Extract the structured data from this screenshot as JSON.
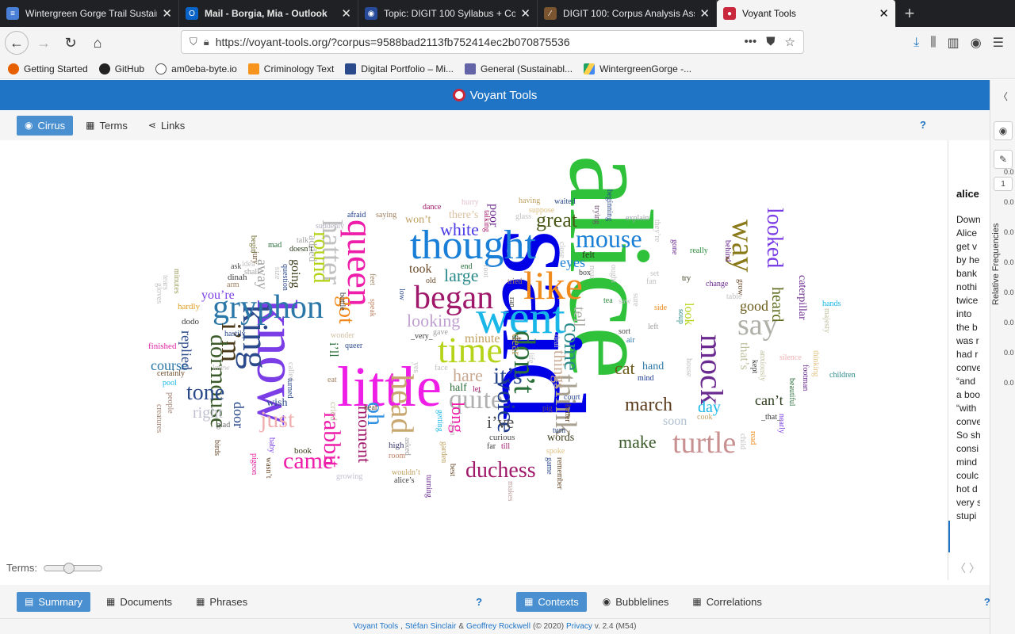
{
  "browser": {
    "tabs": [
      {
        "title": "Wintergreen Gorge Trail Sustain",
        "icon_color": "#4a7fd8",
        "icon": "doc-icon"
      },
      {
        "title": "Mail - Borgia, Mia - Outlook",
        "icon_color": "#0a64c8",
        "icon": "outlook-icon"
      },
      {
        "title": "Topic: DIGIT 100 Syllabus + Co",
        "icon_color": "#284a9b",
        "icon": "globe-icon"
      },
      {
        "title": "DIGIT 100: Corpus Analysis Ass",
        "icon_color": "#7a5530",
        "icon": "feather-icon"
      },
      {
        "title": "Voyant Tools",
        "icon_color": "#c9273b",
        "icon": "voyant-icon"
      }
    ],
    "url": "https://voyant-tools.org/?corpus=9588bad2113fb752414ec2b070875536",
    "bookmarks": [
      {
        "label": "Getting Started",
        "color": "#e66000"
      },
      {
        "label": "GitHub",
        "color": "#222222"
      },
      {
        "label": "am0eba-byte.io",
        "color": "#555555"
      },
      {
        "label": "Criminology Text",
        "color": "#f7941d"
      },
      {
        "label": "Digital Portfolio – Mi...",
        "color": "#2b4a8b"
      },
      {
        "label": "General (Sustainabl...",
        "color": "#6264a7"
      },
      {
        "label": "WintergreenGorge -...",
        "color": "#1fa463"
      }
    ]
  },
  "voyant": {
    "title": "Voyant Tools",
    "top_tabs": [
      "Cirrus",
      "Terms",
      "Links"
    ],
    "help": "?",
    "terms_label": "Terms:",
    "reader": {
      "term": "alice",
      "lines": [
        "Down",
        "Alice",
        "get v",
        "by he",
        "bank",
        "nothi",
        "twice",
        "into",
        "the b",
        "was r",
        "had r",
        "conve",
        "“and",
        "a boo",
        "“with",
        "conve",
        "So sh",
        "consi",
        "mind",
        "coulc",
        "hot d",
        "very s",
        "stupi"
      ]
    },
    "side_axis_label": "Relative Frequencies",
    "side_ticks": [
      "0.0",
      "0.0",
      "0.0",
      "0.0",
      "0.0",
      "0.0",
      "0.0",
      "0.0"
    ],
    "side_page": "1",
    "bottom_tabs_left": [
      "Summary",
      "Documents",
      "Phrases"
    ],
    "bottom_tabs_right": [
      "Contexts",
      "Bubblelines",
      "Correlations"
    ],
    "footer": {
      "tool": "Voyant Tools",
      "author1": "Stéfan Sinclair",
      "amp": "&",
      "author2": "Geoffrey Rockwell",
      "year": "(© 2020)",
      "privacy": "Privacy",
      "version": "v. 2.4 (M54)"
    }
  },
  "cloud_words": [
    {
      "t": "alice",
      "s": 150,
      "c": "#2fc13a",
      "r": 90
    },
    {
      "t": "said",
      "s": 150,
      "c": "#0000e6",
      "r": 90
    },
    {
      "t": "know",
      "s": 72,
      "c": "#7b3ee6",
      "r": 90
    },
    {
      "t": "little",
      "s": 72,
      "c": "#ee1ee6",
      "r": 0
    },
    {
      "t": "went",
      "s": 58,
      "c": "#19b6e8",
      "r": 0
    },
    {
      "t": "thought",
      "s": 52,
      "c": "#1a7fd6",
      "r": 0
    },
    {
      "t": "like",
      "s": 50,
      "c": "#f08a1c",
      "r": 0
    },
    {
      "t": "time",
      "s": 46,
      "c": "#b5d318",
      "r": 0
    },
    {
      "t": "queen",
      "s": 46,
      "c": "#ee1eaa",
      "r": 90
    },
    {
      "t": "king",
      "s": 46,
      "c": "#2b4a8b",
      "r": 90
    },
    {
      "t": "gryphon",
      "s": 42,
      "c": "#2b77a8",
      "r": 0
    },
    {
      "t": "began",
      "s": 42,
      "c": "#a0186a",
      "r": 0
    },
    {
      "t": "head",
      "s": 40,
      "c": "#c8a870",
      "r": 90
    },
    {
      "t": "mock",
      "s": 40,
      "c": "#6b2a8f",
      "r": 90
    },
    {
      "t": "turtle",
      "s": 38,
      "c": "#c89090",
      "r": 0
    },
    {
      "t": "way",
      "s": 40,
      "c": "#8a7a1a",
      "r": 90
    },
    {
      "t": "don't",
      "s": 38,
      "c": "#2a6e3a",
      "r": 90
    },
    {
      "t": "think",
      "s": 38,
      "c": "#a8a090",
      "r": 90
    },
    {
      "t": "say",
      "s": 38,
      "c": "#b0b0a8",
      "r": 0
    },
    {
      "t": "hatter",
      "s": 36,
      "c": "#c0c0c0",
      "r": 90
    },
    {
      "t": "mouse",
      "s": 32,
      "c": "#1a7fd6",
      "r": 0
    },
    {
      "t": "quite",
      "s": 34,
      "c": "#b0b0b0",
      "r": 0
    },
    {
      "t": "i'm",
      "s": 36,
      "c": "#4a3a1a",
      "r": 90
    },
    {
      "t": "duchess",
      "s": 28,
      "c": "#a0186a",
      "r": 0
    },
    {
      "t": "voice",
      "s": 32,
      "c": "#1a3a8b",
      "r": 90
    },
    {
      "t": "dormouse",
      "s": 30,
      "c": "#3a5a2a",
      "r": 90
    },
    {
      "t": "came",
      "s": 30,
      "c": "#ee1eaa",
      "r": 0
    },
    {
      "t": "rabbit",
      "s": 30,
      "c": "#ee1eaa",
      "r": 90
    },
    {
      "t": "just",
      "s": 30,
      "c": "#f0b0b0",
      "r": 0
    },
    {
      "t": "looked",
      "s": 28,
      "c": "#7b3ee6",
      "r": 90
    },
    {
      "t": "it's",
      "s": 30,
      "c": "#2b4a8b",
      "r": 0
    },
    {
      "t": "come",
      "s": 28,
      "c": "#2a8a8a",
      "r": 90
    },
    {
      "t": "round",
      "s": 28,
      "c": "#b5d318",
      "r": 90
    },
    {
      "t": "oh",
      "s": 30,
      "c": "#2f8fe0",
      "r": 90
    },
    {
      "t": "got",
      "s": 28,
      "c": "#f08a1c",
      "r": 90
    },
    {
      "t": "great",
      "s": 26,
      "c": "#4a5a1a",
      "r": 0
    },
    {
      "t": "tone",
      "s": 28,
      "c": "#2b4a8b",
      "r": 0
    },
    {
      "t": "march",
      "s": 24,
      "c": "#5a3a1a",
      "r": 0
    },
    {
      "t": "make",
      "s": 22,
      "c": "#3a5a2a",
      "r": 0
    },
    {
      "t": "white",
      "s": 22,
      "c": "#4a3ae6",
      "r": 0
    },
    {
      "t": "large",
      "s": 22,
      "c": "#2a8a8a",
      "r": 0
    },
    {
      "t": "looking",
      "s": 22,
      "c": "#c0a0d0",
      "r": 0
    },
    {
      "t": "moment",
      "s": 22,
      "c": "#a0186a",
      "r": 90
    },
    {
      "t": "cat",
      "s": 22,
      "c": "#6a5a1a",
      "r": 0
    },
    {
      "t": "long",
      "s": 22,
      "c": "#ee1eaa",
      "r": 90
    },
    {
      "t": "i've",
      "s": 22,
      "c": "#4a4a4a",
      "r": 0
    },
    {
      "t": "hare",
      "s": 22,
      "c": "#c8a890",
      "r": 0
    },
    {
      "t": "things",
      "s": 20,
      "c": "#c8a890",
      "r": 90
    },
    {
      "t": "tell",
      "s": 20,
      "c": "#b0b0a8",
      "r": 90
    },
    {
      "t": "eyes",
      "s": 18,
      "c": "#1a7fd6",
      "r": 0
    },
    {
      "t": "good",
      "s": 18,
      "c": "#6a5a1a",
      "r": 0
    },
    {
      "t": "heard",
      "s": 20,
      "c": "#5a6a1a",
      "r": 90
    },
    {
      "t": "day",
      "s": 20,
      "c": "#19b6e8",
      "r": 0
    },
    {
      "t": "course",
      "s": 18,
      "c": "#2b77a8",
      "r": 0
    },
    {
      "t": "replied",
      "s": 18,
      "c": "#2b4a8b",
      "r": 90
    },
    {
      "t": "right",
      "s": 20,
      "c": "#c0c0d0",
      "r": 0
    },
    {
      "t": "door",
      "s": 18,
      "c": "#2b4a8b",
      "r": 90
    },
    {
      "t": "can't",
      "s": 18,
      "c": "#2a3a1a",
      "r": 0
    },
    {
      "t": "away",
      "s": 18,
      "c": "#a0a0a0",
      "r": 90
    },
    {
      "t": "going",
      "s": 16,
      "c": "#3a3a1a",
      "r": 90
    },
    {
      "t": "took",
      "s": 16,
      "c": "#6a4a2a",
      "r": 0
    },
    {
      "t": "you're",
      "s": 16,
      "c": "#7b3ee6",
      "r": 0
    },
    {
      "t": "soon",
      "s": 16,
      "c": "#b0c0d0",
      "r": 0
    },
    {
      "t": "caterpillar",
      "s": 14,
      "c": "#6b2a8f",
      "r": 90
    },
    {
      "t": "that's",
      "s": 16,
      "c": "#c0c0a0",
      "r": 90
    },
    {
      "t": "poor",
      "s": 16,
      "c": "#6b2a8f",
      "r": 90
    },
    {
      "t": "minute",
      "s": 16,
      "c": "#c0a060",
      "r": 0
    },
    {
      "t": "dear",
      "s": 16,
      "c": "#c0a060",
      "r": 90
    },
    {
      "t": "wish",
      "s": 14,
      "c": "#2b4a8b",
      "r": 0
    },
    {
      "t": "half",
      "s": 14,
      "c": "#2a6e3a",
      "r": 0
    },
    {
      "t": "words",
      "s": 14,
      "c": "#3a3a1a",
      "r": 0
    },
    {
      "t": "i'll",
      "s": 16,
      "c": "#2a6e3a",
      "r": 90
    },
    {
      "t": "look",
      "s": 16,
      "c": "#b5d318",
      "r": 90
    },
    {
      "t": "hand",
      "s": 14,
      "c": "#2b77a8",
      "r": 0
    },
    {
      "t": "felt",
      "s": 12,
      "c": "#2a3a1a",
      "r": 0
    },
    {
      "t": "won't",
      "s": 14,
      "c": "#c0a060",
      "r": 0
    },
    {
      "t": "there's",
      "s": 14,
      "c": "#d8c0a0",
      "r": 0
    },
    {
      "t": "curious",
      "s": 11,
      "c": "#4a4a4a",
      "r": 0
    },
    {
      "t": "added",
      "s": 14,
      "c": "#b0b0b0",
      "r": 90
    },
    {
      "t": "book",
      "s": 11,
      "c": "#3a3a1a",
      "r": 0
    },
    {
      "t": "high",
      "s": 11,
      "c": "#3a3a6a",
      "r": 0
    },
    {
      "t": "cried",
      "s": 12,
      "c": "#c0c0a0",
      "r": 90
    },
    {
      "t": "dinah",
      "s": 11,
      "c": "#3a3a3a",
      "r": 0
    },
    {
      "t": "hardly",
      "s": 11,
      "c": "#e0a020",
      "r": 0
    },
    {
      "t": "finished",
      "s": 11,
      "c": "#e020a0",
      "r": 0
    },
    {
      "t": "dodo",
      "s": 11,
      "c": "#3a3a3a",
      "r": 0
    },
    {
      "t": "certainly",
      "s": 10,
      "c": "#6a4a2a",
      "r": 0
    },
    {
      "t": "pool",
      "s": 10,
      "c": "#19b6e8",
      "r": 0
    },
    {
      "t": "saying",
      "s": 10,
      "c": "#a08060",
      "r": 0
    },
    {
      "t": "afraid",
      "s": 10,
      "c": "#1a3a8b",
      "r": 0
    },
    {
      "t": "dance",
      "s": 10,
      "c": "#a0186a",
      "r": 0
    },
    {
      "t": "hurry",
      "s": 10,
      "c": "#e0c0d0",
      "r": 0
    },
    {
      "t": "having",
      "s": 10,
      "c": "#c0a060",
      "r": 0
    },
    {
      "t": "waited",
      "s": 10,
      "c": "#2b4a8b",
      "r": 0
    },
    {
      "t": "suppose",
      "s": 10,
      "c": "#e0c080",
      "r": 0
    },
    {
      "t": "explain",
      "s": 10,
      "c": "#a0a0b0",
      "r": 0
    },
    {
      "t": "really",
      "s": 10,
      "c": "#2a8a3a",
      "r": 0
    },
    {
      "t": "change",
      "s": 10,
      "c": "#6b2a8f",
      "r": 0
    },
    {
      "t": "try",
      "s": 10,
      "c": "#3a3a1a",
      "r": 0
    },
    {
      "t": "tea",
      "s": 10,
      "c": "#2a8a3a",
      "r": 0
    },
    {
      "t": "saw",
      "s": 10,
      "c": "#c0c0c0",
      "r": 0
    },
    {
      "t": "side",
      "s": 10,
      "c": "#f08a1c",
      "r": 0
    },
    {
      "t": "sort",
      "s": 10,
      "c": "#4a4a4a",
      "r": 0
    },
    {
      "t": "air",
      "s": 10,
      "c": "#2b77a8",
      "r": 0
    },
    {
      "t": "left",
      "s": 10,
      "c": "#a0a0a0",
      "r": 0
    },
    {
      "t": "mind",
      "s": 10,
      "c": "#1a3a8b",
      "r": 0
    },
    {
      "t": "court",
      "s": 10,
      "c": "#2b4a8b",
      "r": 0
    },
    {
      "t": "pig",
      "s": 10,
      "c": "#6a4a6a",
      "r": 0
    },
    {
      "t": "turn",
      "s": 10,
      "c": "#2b4a8b",
      "r": 0
    },
    {
      "t": "spoke",
      "s": 10,
      "c": "#e0c080",
      "r": 0
    },
    {
      "t": "far",
      "s": 10,
      "c": "#3a3a3a",
      "r": 0
    },
    {
      "t": "till",
      "s": 10,
      "c": "#a0186a",
      "r": 0
    },
    {
      "t": "room",
      "s": 10,
      "c": "#c08060",
      "r": 0
    },
    {
      "t": "alice's",
      "s": 10,
      "c": "#3a3a3a",
      "r": 0
    },
    {
      "t": "growing",
      "s": 10,
      "c": "#c0c0d0",
      "r": 0
    },
    {
      "t": "pigeon",
      "s": 10,
      "c": "#e020a0",
      "r": 90
    },
    {
      "t": "birds",
      "s": 10,
      "c": "#6a4a2a",
      "r": 90
    },
    {
      "t": "glad",
      "s": 10,
      "c": "#6a6a6a",
      "r": 0
    },
    {
      "t": "knew",
      "s": 10,
      "c": "#c0c0c0",
      "r": 0
    },
    {
      "t": "children",
      "s": 10,
      "c": "#2a8a8a",
      "r": 0
    },
    {
      "t": "hands",
      "s": 10,
      "c": "#19b6e8",
      "r": 0
    },
    {
      "t": "table",
      "s": 10,
      "c": "#c0c0c0",
      "r": 0
    },
    {
      "t": "footman",
      "s": 10,
      "c": "#6b2a8f",
      "r": 90
    },
    {
      "t": "beautiful",
      "s": 10,
      "c": "#2a6e3a",
      "r": 90
    },
    {
      "t": "silence",
      "s": 10,
      "c": "#f0b0b0",
      "r": 0
    },
    {
      "t": "thinking",
      "s": 10,
      "c": "#e0c080",
      "r": 90
    },
    {
      "t": "read",
      "s": 10,
      "c": "#f08a1c",
      "r": 90
    },
    {
      "t": "nearly",
      "s": 10,
      "c": "#7b3ee6",
      "r": 90
    },
    {
      "t": "child",
      "s": 10,
      "c": "#c0c0c0",
      "r": 90
    },
    {
      "t": "remember",
      "s": 10,
      "c": "#6a4a2a",
      "r": 90
    },
    {
      "t": "best",
      "s": 10,
      "c": "#6a4a2a",
      "r": 90
    },
    {
      "t": "turning",
      "s": 10,
      "c": "#6b2a8f",
      "r": 90
    },
    {
      "t": "makes",
      "s": 10,
      "c": "#c0a0a0",
      "r": 90
    },
    {
      "t": "wouldn't",
      "s": 10,
      "c": "#c0a060",
      "r": 0
    },
    {
      "t": "wasn't",
      "s": 10,
      "c": "#6a4a2a",
      "r": 90
    },
    {
      "t": "baby",
      "s": 10,
      "c": "#7b3ee6",
      "r": 90
    },
    {
      "t": "creatures",
      "s": 10,
      "c": "#a08070",
      "r": 90
    },
    {
      "t": "people",
      "s": 10,
      "c": "#a08070",
      "r": 90
    },
    {
      "t": "minutes",
      "s": 10,
      "c": "#a0a060",
      "r": 90
    },
    {
      "t": "hastily",
      "s": 10,
      "c": "#2b4a8b",
      "r": 0
    },
    {
      "t": "ask",
      "s": 10,
      "c": "#4a4a4a",
      "r": 0
    },
    {
      "t": "arm",
      "s": 10,
      "c": "#a08060",
      "r": 0
    },
    {
      "t": "shall",
      "s": 10,
      "c": "#a0a0a0",
      "r": 0
    },
    {
      "t": "mad",
      "s": 10,
      "c": "#2a6e3a",
      "r": 0
    },
    {
      "t": "talk",
      "s": 10,
      "c": "#a0a0a0",
      "r": 0
    },
    {
      "t": "doesn't",
      "s": 10,
      "c": "#2a3a1a",
      "r": 0
    },
    {
      "t": "suddenly",
      "s": 10,
      "c": "#b0b0c0",
      "r": 0
    },
    {
      "t": "question",
      "s": 10,
      "c": "#2b4a8b",
      "r": 90
    },
    {
      "t": "end",
      "s": 10,
      "c": "#2a6e3a",
      "r": 0
    },
    {
      "t": "old",
      "s": 10,
      "c": "#6a4a2a",
      "r": 0
    },
    {
      "t": "low",
      "s": 10,
      "c": "#2b4a8b",
      "r": 90
    },
    {
      "t": "tried",
      "s": 10,
      "c": "#a08060",
      "r": 0
    },
    {
      "t": "ran",
      "s": 10,
      "c": "#4a4a4a",
      "r": 90
    },
    {
      "t": "bit",
      "s": 10,
      "c": "#4a4a4a",
      "r": 0
    },
    {
      "t": "soup",
      "s": 10,
      "c": "#2a8a8a",
      "r": 90
    },
    {
      "t": "beginning",
      "s": 10,
      "c": "#2b4a8b",
      "r": 90
    },
    {
      "t": "trying",
      "s": 10,
      "c": "#6a4a6a",
      "r": 90
    },
    {
      "t": "behind",
      "s": 10,
      "c": "#6b2a8f",
      "r": 90
    },
    {
      "t": "gone",
      "s": 10,
      "c": "#6b2a8f",
      "r": 90
    },
    {
      "t": "grow",
      "s": 10,
      "c": "#6a4a2a",
      "r": 90
    },
    {
      "t": "kept",
      "s": 10,
      "c": "#3a3a3a",
      "r": 90
    },
    {
      "t": "anxiously",
      "s": 10,
      "c": "#c0c0a0",
      "r": 90
    },
    {
      "t": "box",
      "s": 10,
      "c": "#3a3a3a",
      "r": 0
    },
    {
      "t": "hear",
      "s": 10,
      "c": "#6a4a2a",
      "r": 0
    },
    {
      "t": "eat",
      "s": 10,
      "c": "#a08060",
      "r": 0
    },
    {
      "t": "called",
      "s": 10,
      "c": "#c0c0c0",
      "r": 90
    },
    {
      "t": "turned",
      "s": 10,
      "c": "#2b4a8b",
      "r": 90
    },
    {
      "t": "size",
      "s": 10,
      "c": "#c0c0c0",
      "r": 90
    },
    {
      "t": "jury",
      "s": 10,
      "c": "#6a4a2a",
      "r": 90
    },
    {
      "t": "begin",
      "s": 10,
      "c": "#6a6a2a",
      "r": 90
    },
    {
      "t": "idea",
      "s": 10,
      "c": "#c0c0c0",
      "r": 0
    },
    {
      "t": "gloves",
      "s": 10,
      "c": "#c0c0c0",
      "r": 90
    },
    {
      "t": "tears",
      "s": 10,
      "c": "#c0c0c0",
      "r": 90
    },
    {
      "t": "wonder",
      "s": 10,
      "c": "#d0c0a0",
      "r": 0
    },
    {
      "t": "queer",
      "s": 10,
      "c": "#2b4a8b",
      "r": 0
    },
    {
      "t": "bottle",
      "s": 10,
      "c": "#3a3a3a",
      "r": 90
    },
    {
      "t": "feet",
      "s": 10,
      "c": "#a08060",
      "r": 90
    },
    {
      "t": "speak",
      "s": 10,
      "c": "#c08060",
      "r": 90
    },
    {
      "t": "getting",
      "s": 10,
      "c": "#19b6e8",
      "r": 90
    },
    {
      "t": "seen",
      "s": 10,
      "c": "#c0c0c0",
      "r": 90
    },
    {
      "t": "asked",
      "s": 10,
      "c": "#a0a0a0",
      "r": 90
    },
    {
      "t": "garden",
      "s": 10,
      "c": "#c0a060",
      "r": 90
    },
    {
      "t": "let",
      "s": 10,
      "c": "#a0186a",
      "r": 0
    },
    {
      "t": "face",
      "s": 10,
      "c": "#c0c0c0",
      "r": 0
    },
    {
      "t": "gave",
      "s": 10,
      "c": "#a0a0a0",
      "r": 0
    },
    {
      "t": "yes",
      "s": 10,
      "c": "#c0c0c0",
      "r": 90
    },
    {
      "t": "cook",
      "s": 10,
      "c": "#c0a060",
      "r": 0
    },
    {
      "t": "house",
      "s": 10,
      "c": "#c0c0c0",
      "r": 90
    },
    {
      "t": "majesty",
      "s": 10,
      "c": "#c0c0a0",
      "r": 90
    },
    {
      "t": "game",
      "s": 10,
      "c": "#2b4a8b",
      "r": 90
    },
    {
      "t": "better",
      "s": 10,
      "c": "#6a4a2a",
      "r": 90
    },
    {
      "t": "sure",
      "s": 10,
      "c": "#c0c0c0",
      "r": 90
    },
    {
      "t": "set",
      "s": 10,
      "c": "#c0c0c0",
      "r": 0
    },
    {
      "t": "fan",
      "s": 10,
      "c": "#c0c0c0",
      "r": 0
    },
    {
      "t": "near",
      "s": 10,
      "c": "#c0c0c0",
      "r": 90
    },
    {
      "t": "close",
      "s": 10,
      "c": "#c0c0c0",
      "r": 90
    },
    {
      "t": "glass",
      "s": 10,
      "c": "#c0c0c0",
      "r": 0
    },
    {
      "t": "talking",
      "s": 10,
      "c": "#a0186a",
      "r": 90
    },
    {
      "t": "foot",
      "s": 10,
      "c": "#c0c0c0",
      "r": 90
    },
    {
      "t": "they're",
      "s": 10,
      "c": "#c0c0c0",
      "r": 90
    },
    {
      "t": "_that_",
      "s": 10,
      "c": "#3a3a3a",
      "r": 0
    },
    {
      "t": "_very_",
      "s": 10,
      "c": "#3a3a3a",
      "r": 0
    },
    {
      "t": "ought",
      "s": 10,
      "c": "#c0c0c0",
      "r": 90
    },
    {
      "t": "life",
      "s": 10,
      "c": "#c0c0c0",
      "r": 90
    },
    {
      "t": "deal",
      "s": 10,
      "c": "#c0c0c0",
      "r": 90
    }
  ]
}
